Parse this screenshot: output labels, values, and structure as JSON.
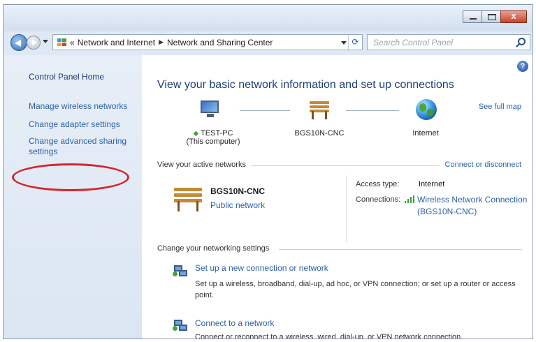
{
  "address": {
    "crumbs": [
      "Network and Internet",
      "Network and Sharing Center"
    ],
    "overflow_glyph": "«"
  },
  "search": {
    "placeholder": "Search Control Panel"
  },
  "window_buttons": {
    "close_glyph": "x"
  },
  "sidebar": {
    "items": [
      {
        "label": "Control Panel Home"
      },
      {
        "label": "Manage wireless networks"
      },
      {
        "label": "Change adapter settings"
      },
      {
        "label": "Change advanced sharing settings"
      }
    ]
  },
  "help_glyph": "?",
  "main": {
    "heading": "View your basic network information and set up connections",
    "see_full_map": "See full map",
    "map": {
      "nodes": [
        {
          "name": "TEST-PC",
          "sub": "(This computer)"
        },
        {
          "name": "BGS10N-CNC"
        },
        {
          "name": "Internet"
        }
      ]
    },
    "active": {
      "title": "View your active networks",
      "connect_link": "Connect or disconnect",
      "network_name": "BGS10N-CNC",
      "network_type": "Public network",
      "access_label": "Access type:",
      "access_value": "Internet",
      "connections_label": "Connections:",
      "connection_name": "Wireless Network Connection",
      "connection_sub": "(BGS10N-CNC)"
    },
    "settings": {
      "title": "Change your networking settings",
      "items": [
        {
          "title": "Set up a new connection or network",
          "desc_line1": "Set up a wireless, broadband, dial-up, ad hoc, or VPN connection; or set up a router or access",
          "desc_line2": "point."
        },
        {
          "title": "Connect to a network",
          "desc_line1": "Connect or reconnect to a wireless, wired, dial-up, or VPN network connection."
        }
      ]
    }
  },
  "colors": {
    "link": "#2d5fa8",
    "heading": "#1e3f7a",
    "callout": "#d8232a",
    "sidebar_bg": "#e7eef7"
  },
  "icons": {
    "back": "back-arrow-icon",
    "forward": "forward-arrow-icon",
    "control_panel": "control-panel-icon",
    "refresh": "refresh-icon",
    "search": "search-icon",
    "help": "help-icon",
    "computer": "computer-monitor-icon",
    "network": "bench-network-icon",
    "internet": "globe-icon",
    "signal": "wireless-signal-icon",
    "setup": "network-setup-icon",
    "connect": "connect-network-icon"
  }
}
